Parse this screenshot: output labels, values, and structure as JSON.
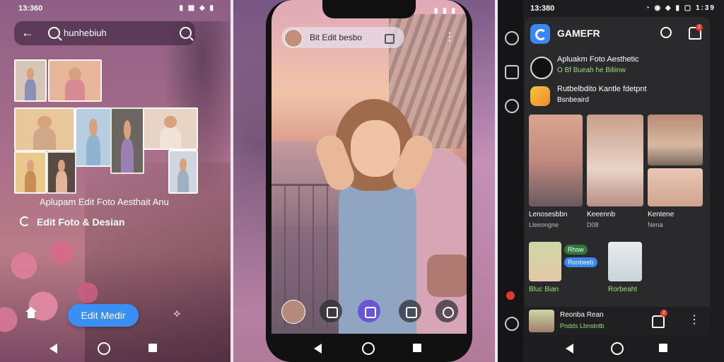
{
  "panel1": {
    "status_time": "13:360",
    "status_icons": "▮ ▦ ◈ ▮",
    "search_text": "hunhebiuh",
    "caption": "Aplupam Edit Foto Aesthait Anu",
    "edit_row": "Edit Foto & Desian",
    "cta": "Edit Medir",
    "puzzle_glyph": "⟡"
  },
  "panel2": {
    "status_time": "",
    "status_icons": "▮ ▮ ▮",
    "pill_text": "Bit Edit besbo",
    "menu_glyph": "⋮"
  },
  "panel3": {
    "status_time": "13:380",
    "status_icons": "◔ ◉ ◈ ▮ ▢ 1:39",
    "app_title": "GAMEFR",
    "bell_badge": "2",
    "row1_title": "Apluakm Foto Aesthetic",
    "row1_sub": "O Bf Bueah he Biliinw",
    "row2_title": "Rutbelbdito Kantle fdetpnt",
    "row2_sub": "Bsnbeaird",
    "tiles": [
      {
        "label": "Lenosesbbn",
        "sub": "Lleeongne"
      },
      {
        "label": "Keeennb",
        "sub": "D08"
      },
      {
        "label": "Kentene",
        "sub": "Nena"
      }
    ],
    "mini1_chip1": "Rhsw",
    "mini1_chip2": "Ronbeeb",
    "mini1_label": "Bluc Bian",
    "mini2_label": "Rorbeaht",
    "bottom_title": "Reonba Rean",
    "bottom_sub": "Pndds Lbnstntb",
    "bottom_badge": "2",
    "menu_glyph": "⋮"
  }
}
